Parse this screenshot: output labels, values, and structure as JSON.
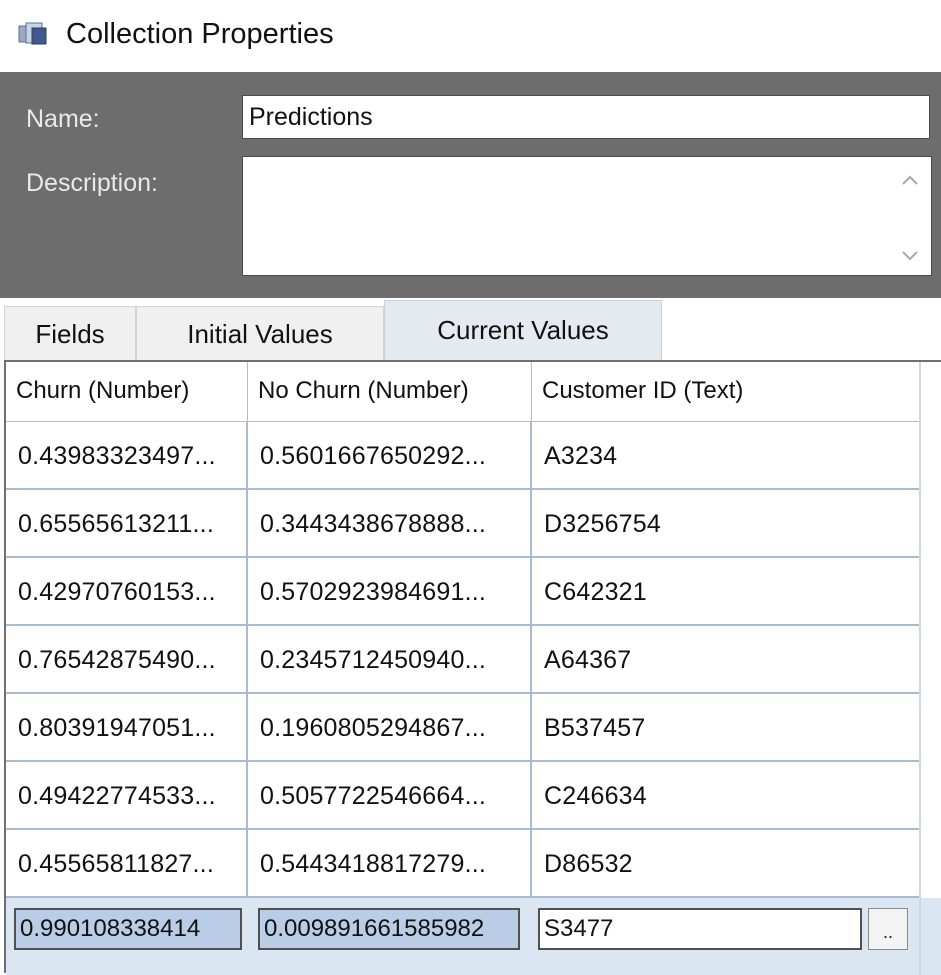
{
  "window": {
    "title": "Collection Properties",
    "icon": "collection-icon"
  },
  "header": {
    "name_label": "Name:",
    "name_value": "Predictions",
    "description_label": "Description:",
    "description_value": ""
  },
  "tabs": [
    {
      "label": "Fields"
    },
    {
      "label": "Initial Values"
    },
    {
      "label": "Current Values",
      "active": true
    }
  ],
  "grid": {
    "columns": [
      "Churn  (Number)",
      "No Churn  (Number)",
      "Customer ID  (Text)"
    ],
    "rows": [
      [
        "0.43983323497...",
        "0.5601667650292...",
        "A3234"
      ],
      [
        "0.65565613211...",
        "0.3443438678888...",
        "D3256754"
      ],
      [
        "0.42970760153...",
        "0.5702923984691...",
        "C642321"
      ],
      [
        "0.76542875490...",
        "0.2345712450940...",
        "A64367"
      ],
      [
        "0.80391947051...",
        "0.1960805294867...",
        "B537457"
      ],
      [
        "0.49422774533...",
        "0.5057722546664...",
        "C246634"
      ],
      [
        "0.45565811827...",
        "0.5443418817279...",
        "D86532"
      ]
    ],
    "edit_row": {
      "churn": "0.990108338414",
      "no_churn": "0.009891661585982",
      "customer_id": "S3477",
      "ellipsis_label": ".."
    }
  },
  "colors": {
    "header_panel": "#6d6d6d",
    "active_tab": "#e5eaf0",
    "selection": "#b9cde6",
    "grid_line": "#a9bbd0"
  }
}
